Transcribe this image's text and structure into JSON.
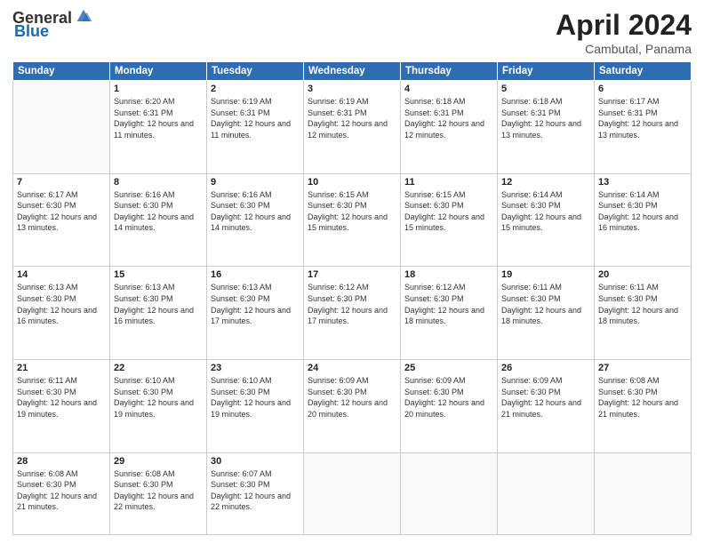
{
  "header": {
    "logo_general": "General",
    "logo_blue": "Blue",
    "title": "April 2024",
    "location": "Cambutal, Panama"
  },
  "days_of_week": [
    "Sunday",
    "Monday",
    "Tuesday",
    "Wednesday",
    "Thursday",
    "Friday",
    "Saturday"
  ],
  "weeks": [
    [
      {
        "day": "",
        "sunrise": "",
        "sunset": "",
        "daylight": ""
      },
      {
        "day": "1",
        "sunrise": "Sunrise: 6:20 AM",
        "sunset": "Sunset: 6:31 PM",
        "daylight": "Daylight: 12 hours and 11 minutes."
      },
      {
        "day": "2",
        "sunrise": "Sunrise: 6:19 AM",
        "sunset": "Sunset: 6:31 PM",
        "daylight": "Daylight: 12 hours and 11 minutes."
      },
      {
        "day": "3",
        "sunrise": "Sunrise: 6:19 AM",
        "sunset": "Sunset: 6:31 PM",
        "daylight": "Daylight: 12 hours and 12 minutes."
      },
      {
        "day": "4",
        "sunrise": "Sunrise: 6:18 AM",
        "sunset": "Sunset: 6:31 PM",
        "daylight": "Daylight: 12 hours and 12 minutes."
      },
      {
        "day": "5",
        "sunrise": "Sunrise: 6:18 AM",
        "sunset": "Sunset: 6:31 PM",
        "daylight": "Daylight: 12 hours and 13 minutes."
      },
      {
        "day": "6",
        "sunrise": "Sunrise: 6:17 AM",
        "sunset": "Sunset: 6:31 PM",
        "daylight": "Daylight: 12 hours and 13 minutes."
      }
    ],
    [
      {
        "day": "7",
        "sunrise": "Sunrise: 6:17 AM",
        "sunset": "Sunset: 6:30 PM",
        "daylight": "Daylight: 12 hours and 13 minutes."
      },
      {
        "day": "8",
        "sunrise": "Sunrise: 6:16 AM",
        "sunset": "Sunset: 6:30 PM",
        "daylight": "Daylight: 12 hours and 14 minutes."
      },
      {
        "day": "9",
        "sunrise": "Sunrise: 6:16 AM",
        "sunset": "Sunset: 6:30 PM",
        "daylight": "Daylight: 12 hours and 14 minutes."
      },
      {
        "day": "10",
        "sunrise": "Sunrise: 6:15 AM",
        "sunset": "Sunset: 6:30 PM",
        "daylight": "Daylight: 12 hours and 15 minutes."
      },
      {
        "day": "11",
        "sunrise": "Sunrise: 6:15 AM",
        "sunset": "Sunset: 6:30 PM",
        "daylight": "Daylight: 12 hours and 15 minutes."
      },
      {
        "day": "12",
        "sunrise": "Sunrise: 6:14 AM",
        "sunset": "Sunset: 6:30 PM",
        "daylight": "Daylight: 12 hours and 15 minutes."
      },
      {
        "day": "13",
        "sunrise": "Sunrise: 6:14 AM",
        "sunset": "Sunset: 6:30 PM",
        "daylight": "Daylight: 12 hours and 16 minutes."
      }
    ],
    [
      {
        "day": "14",
        "sunrise": "Sunrise: 6:13 AM",
        "sunset": "Sunset: 6:30 PM",
        "daylight": "Daylight: 12 hours and 16 minutes."
      },
      {
        "day": "15",
        "sunrise": "Sunrise: 6:13 AM",
        "sunset": "Sunset: 6:30 PM",
        "daylight": "Daylight: 12 hours and 16 minutes."
      },
      {
        "day": "16",
        "sunrise": "Sunrise: 6:13 AM",
        "sunset": "Sunset: 6:30 PM",
        "daylight": "Daylight: 12 hours and 17 minutes."
      },
      {
        "day": "17",
        "sunrise": "Sunrise: 6:12 AM",
        "sunset": "Sunset: 6:30 PM",
        "daylight": "Daylight: 12 hours and 17 minutes."
      },
      {
        "day": "18",
        "sunrise": "Sunrise: 6:12 AM",
        "sunset": "Sunset: 6:30 PM",
        "daylight": "Daylight: 12 hours and 18 minutes."
      },
      {
        "day": "19",
        "sunrise": "Sunrise: 6:11 AM",
        "sunset": "Sunset: 6:30 PM",
        "daylight": "Daylight: 12 hours and 18 minutes."
      },
      {
        "day": "20",
        "sunrise": "Sunrise: 6:11 AM",
        "sunset": "Sunset: 6:30 PM",
        "daylight": "Daylight: 12 hours and 18 minutes."
      }
    ],
    [
      {
        "day": "21",
        "sunrise": "Sunrise: 6:11 AM",
        "sunset": "Sunset: 6:30 PM",
        "daylight": "Daylight: 12 hours and 19 minutes."
      },
      {
        "day": "22",
        "sunrise": "Sunrise: 6:10 AM",
        "sunset": "Sunset: 6:30 PM",
        "daylight": "Daylight: 12 hours and 19 minutes."
      },
      {
        "day": "23",
        "sunrise": "Sunrise: 6:10 AM",
        "sunset": "Sunset: 6:30 PM",
        "daylight": "Daylight: 12 hours and 19 minutes."
      },
      {
        "day": "24",
        "sunrise": "Sunrise: 6:09 AM",
        "sunset": "Sunset: 6:30 PM",
        "daylight": "Daylight: 12 hours and 20 minutes."
      },
      {
        "day": "25",
        "sunrise": "Sunrise: 6:09 AM",
        "sunset": "Sunset: 6:30 PM",
        "daylight": "Daylight: 12 hours and 20 minutes."
      },
      {
        "day": "26",
        "sunrise": "Sunrise: 6:09 AM",
        "sunset": "Sunset: 6:30 PM",
        "daylight": "Daylight: 12 hours and 21 minutes."
      },
      {
        "day": "27",
        "sunrise": "Sunrise: 6:08 AM",
        "sunset": "Sunset: 6:30 PM",
        "daylight": "Daylight: 12 hours and 21 minutes."
      }
    ],
    [
      {
        "day": "28",
        "sunrise": "Sunrise: 6:08 AM",
        "sunset": "Sunset: 6:30 PM",
        "daylight": "Daylight: 12 hours and 21 minutes."
      },
      {
        "day": "29",
        "sunrise": "Sunrise: 6:08 AM",
        "sunset": "Sunset: 6:30 PM",
        "daylight": "Daylight: 12 hours and 22 minutes."
      },
      {
        "day": "30",
        "sunrise": "Sunrise: 6:07 AM",
        "sunset": "Sunset: 6:30 PM",
        "daylight": "Daylight: 12 hours and 22 minutes."
      },
      {
        "day": "",
        "sunrise": "",
        "sunset": "",
        "daylight": ""
      },
      {
        "day": "",
        "sunrise": "",
        "sunset": "",
        "daylight": ""
      },
      {
        "day": "",
        "sunrise": "",
        "sunset": "",
        "daylight": ""
      },
      {
        "day": "",
        "sunrise": "",
        "sunset": "",
        "daylight": ""
      }
    ]
  ]
}
